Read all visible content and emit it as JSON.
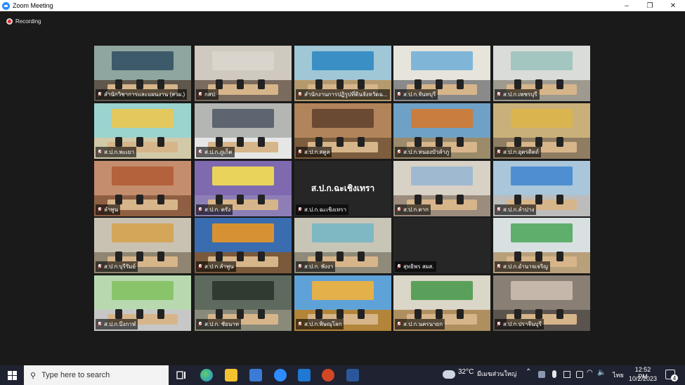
{
  "window": {
    "title": "Zoom Meeting",
    "controls": [
      "–",
      "❐",
      "✕"
    ]
  },
  "recording": {
    "label": "Recording"
  },
  "tiles": [
    {
      "name": "สำนักวิชาการและแผนงาน (สวผ.)",
      "muted": true,
      "active": true,
      "wall": "#8fa6a0",
      "floor": "#5f574c",
      "banner": "#3d5a6a"
    },
    {
      "name": "กสป.",
      "muted": true,
      "wall": "#cfc9bf",
      "floor": "#7b6b5e",
      "banner": "#d9d4cc"
    },
    {
      "name": "สำนักงานการปฏิรูปที่ดินจังหวัดฉ...",
      "muted": true,
      "wall": "#9fc7d6",
      "floor": "#b59a6e",
      "banner": "#3a8fc5"
    },
    {
      "name": "ส.ป.ก.จันทบุรี",
      "muted": true,
      "wall": "#e7e4dc",
      "floor": "#8a8a8a",
      "banner": "#7fb6d8"
    },
    {
      "name": "ส.ป.ก.เพชรบุรี",
      "muted": true,
      "wall": "#d9dcd8",
      "floor": "#9e9a8f",
      "banner": "#a3c6c0"
    },
    {
      "name": "ส.ป.ก.พะเยา",
      "muted": true,
      "wall": "#9bd3cf",
      "floor": "#d2c9a8",
      "banner": "#e2c85d"
    },
    {
      "name": "ส.ป.ก.ภูเก็ต",
      "muted": true,
      "wall": "#b3b6b2",
      "floor": "#e6e6e6",
      "banner": "#5d6570"
    },
    {
      "name": "ส.ป.ก.สตูล",
      "muted": true,
      "wall": "#b2845b",
      "floor": "#7c5d3d",
      "banner": "#6a4a32"
    },
    {
      "name": "ส.ป.ก.หนองบัวลำภู",
      "muted": true,
      "wall": "#6fa1c6",
      "floor": "#9b8b6b",
      "banner": "#c97d3e"
    },
    {
      "name": "ส.ป.ก.อุตรดิตถ์",
      "muted": true,
      "wall": "#c9b07a",
      "floor": "#8f7d62",
      "banner": "#d9b44f"
    },
    {
      "name": "ลำพูน",
      "muted": true,
      "wall": "#c48d6d",
      "floor": "#8f5f44",
      "banner": "#b4623c"
    },
    {
      "name": "ส.ป.ก. ตรัง",
      "muted": true,
      "wall": "#7f6ab0",
      "floor": "#8d7fb6",
      "banner": "#e9d35a"
    },
    {
      "name": "ส.ป.ก.ฉะเชิงเทรา",
      "muted": true,
      "black": true,
      "center": "ส.ป.ก.ฉะเชิงเทรา"
    },
    {
      "name": "ส.ป.ก.ตาก",
      "muted": true,
      "wall": "#d8d1c6",
      "floor": "#9b8c7e",
      "banner": "#9fbad0"
    },
    {
      "name": "ส.ป.ก.ลำปาง",
      "muted": true,
      "wall": "#a9c6da",
      "floor": "#bcbcbc",
      "banner": "#4f8ed1"
    },
    {
      "name": "ส.ป.ก.บุรีรัมย์",
      "muted": true,
      "wall": "#c9c2b2",
      "floor": "#8f8570",
      "banner": "#d4a65a"
    },
    {
      "name": "ส.ป.ก.ลำพูน",
      "muted": true,
      "wall": "#3a6cb0",
      "floor": "#7a5a3a",
      "banner": "#d69232"
    },
    {
      "name": "ส.ป.ก. พังงา",
      "muted": true,
      "wall": "#c7c5b6",
      "floor": "#8f8a7a",
      "banner": "#7fb8c2"
    },
    {
      "name": "สุทธิพร สผส.",
      "muted": true,
      "black": true,
      "center": ""
    },
    {
      "name": "ส.ป.ก.อำนาจเจริญ",
      "muted": true,
      "wall": "#d8e0e2",
      "floor": "#b8a07a",
      "banner": "#5fae6b"
    },
    {
      "name": "ส.ป.ก.บึงกาฬ",
      "muted": true,
      "wall": "#b8d9b0",
      "floor": "#c7c7c7",
      "banner": "#8ac46a"
    },
    {
      "name": "ส.ป.ก. ชัยนาท",
      "muted": true,
      "wall": "#5e6a5e",
      "floor": "#8a8a7a",
      "banner": "#2f3a30"
    },
    {
      "name": "ส.ป.ก.พิษณุโลก",
      "muted": true,
      "wall": "#5fa2d8",
      "floor": "#b3853a",
      "banner": "#e3b04a"
    },
    {
      "name": "ส.ป.ก.นครนายก",
      "muted": true,
      "wall": "#dad6c8",
      "floor": "#b08f5f",
      "banner": "#5aa05a"
    },
    {
      "name": "ส.ป.ก.ปราจีนบุรี",
      "muted": true,
      "wall": "#8a7f75",
      "floor": "#5b544e",
      "banner": "#c5b7a9"
    }
  ],
  "taskbar": {
    "search_placeholder": "Type here to search",
    "temperature": "32°C",
    "weather": "มีเมฆส่วนใหญ่",
    "language": "ไทย",
    "time": "12:52 PM",
    "date": "10/2/2023",
    "notifications": "4",
    "apps": [
      {
        "name": "task-view",
        "color": "#1f2230"
      },
      {
        "name": "edge",
        "color": "#1e8bd2"
      },
      {
        "name": "file-explorer",
        "color": "#f2c230"
      },
      {
        "name": "store",
        "color": "#3a7bd5"
      },
      {
        "name": "zoom",
        "color": "#2d8cff"
      },
      {
        "name": "mail",
        "color": "#1f78d1"
      },
      {
        "name": "powerpoint",
        "color": "#d24726"
      },
      {
        "name": "word",
        "color": "#2b579a"
      }
    ]
  }
}
